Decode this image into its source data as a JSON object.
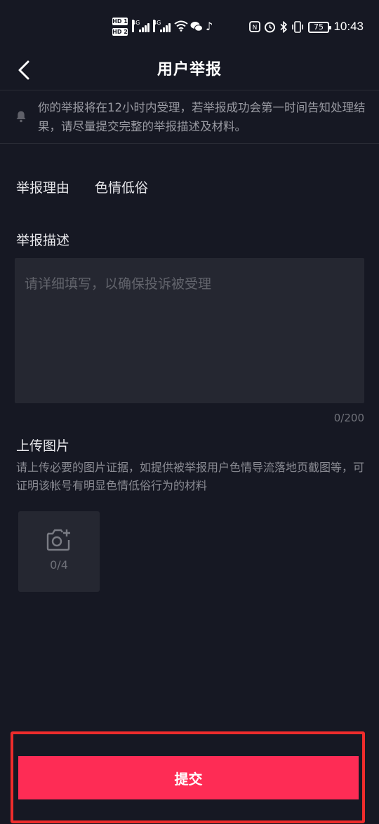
{
  "status_bar": {
    "time": "10:43",
    "battery": "75",
    "hd1": "HD 1",
    "hd2": "HD 2",
    "net1": "4G",
    "net2": "4G",
    "icons": [
      "hd-icon",
      "signal-icon",
      "wifi-icon",
      "wechat-icon",
      "tiktok-icon",
      "nfc-icon",
      "alarm-icon",
      "bluetooth-icon",
      "vibrate-icon",
      "battery-icon"
    ]
  },
  "header": {
    "title": "用户举报",
    "back_icon": "chevron-left-icon"
  },
  "notice": {
    "icon": "bell-icon",
    "text": "你的举报将在12小时内受理，若举报成功会第一时间告知处理结果，请尽量提交完整的举报描述及材料。"
  },
  "reason": {
    "label": "举报理由",
    "value": "色情低俗"
  },
  "description": {
    "label": "举报描述",
    "placeholder": "请详细填写，以确保投诉被受理",
    "value": "",
    "count": "0/200"
  },
  "upload": {
    "label": "上传图片",
    "hint": "请上传必要的图片证据，如提供被举报用户色情导流落地页截图等，可证明该帐号有明显色情低俗行为的材料",
    "count": "0/4",
    "icon": "camera-add-icon"
  },
  "submit": {
    "label": "提交"
  },
  "colors": {
    "background": "#161823",
    "accent": "#fe2c55",
    "input_bg": "#252731",
    "highlight": "#ee2c2c"
  }
}
